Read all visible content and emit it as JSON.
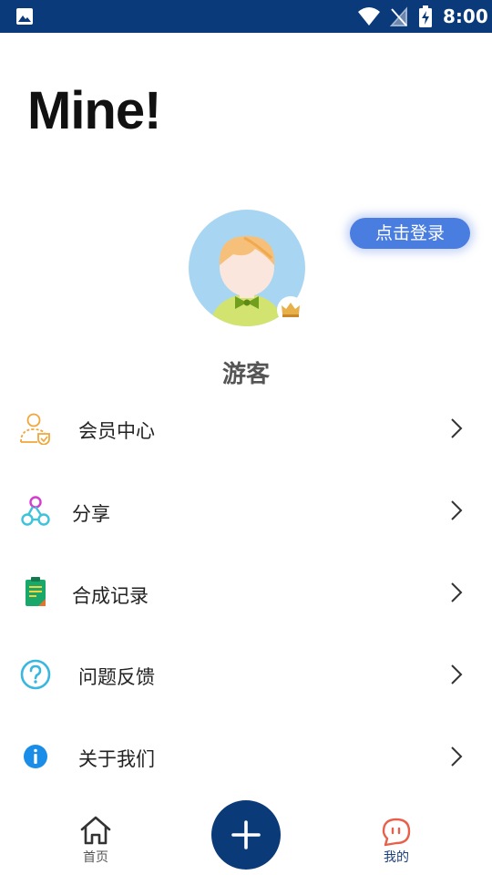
{
  "status_bar": {
    "time": "8:00",
    "icons": [
      "gallery-icon",
      "wifi-icon",
      "signal-off-icon",
      "battery-charging-icon"
    ],
    "background": "#0a3a7a"
  },
  "page": {
    "title": "Mine!"
  },
  "profile": {
    "login_button": "点击登录",
    "user_name": "游客",
    "avatar": "avatar-boy-illustration",
    "badge": "crown-icon"
  },
  "menu": [
    {
      "label": "会员中心",
      "icon": "member-center-icon"
    },
    {
      "label": "分享",
      "icon": "share-icon"
    },
    {
      "label": "合成记录",
      "icon": "synthesis-record-icon"
    },
    {
      "label": "问题反馈",
      "icon": "question-feedback-icon"
    },
    {
      "label": "关于我们",
      "icon": "info-icon"
    }
  ],
  "bottom_nav": {
    "home_label": "首页",
    "add_icon": "plus-icon",
    "mine_label": "我的",
    "active": "我的",
    "colors": {
      "accent": "#0b3a78",
      "mine_icon": "#e8604a"
    }
  }
}
